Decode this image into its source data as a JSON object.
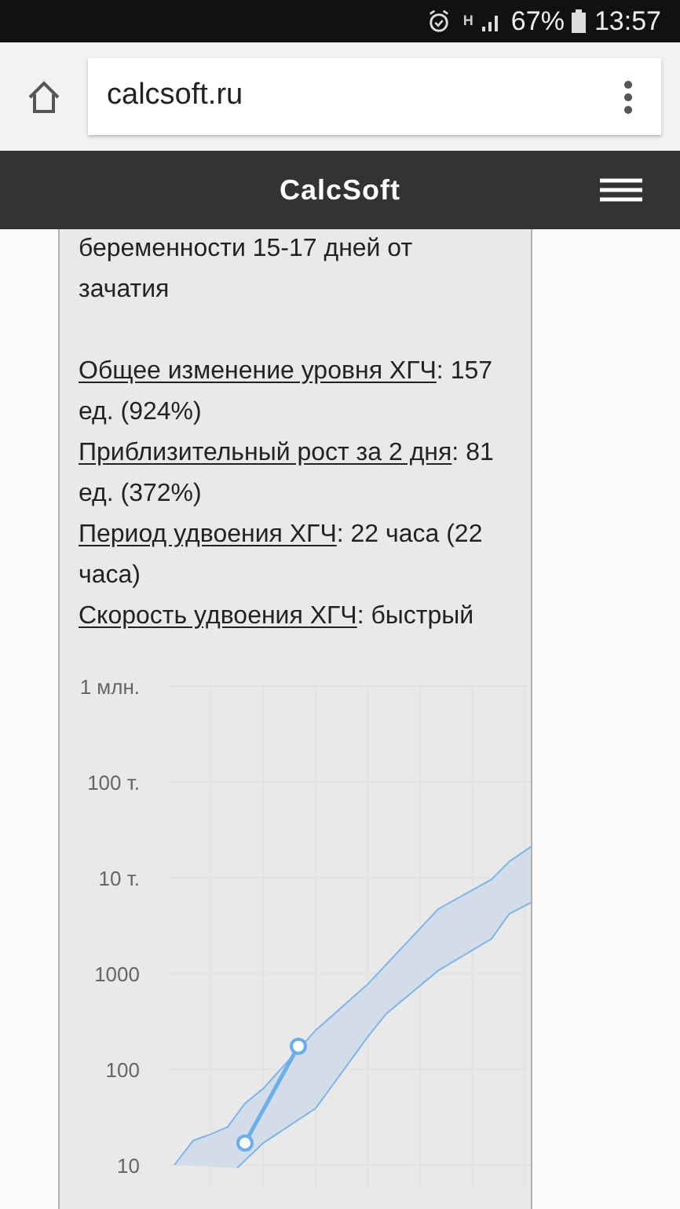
{
  "status_bar": {
    "network": "H",
    "battery": "67%",
    "time": "13:57"
  },
  "browser": {
    "url": "calcsoft.ru"
  },
  "header": {
    "title": "CalcSoft"
  },
  "result": {
    "intro": "беременности 15-17 дней от зачатия",
    "stats": [
      {
        "label": "Общее изменение уровня ХГЧ",
        "value": ": 157 ед. (924%)"
      },
      {
        "label": "Приблизительный рост за 2 дня",
        "value": ": 81 ед. (372%)"
      },
      {
        "label": "Период удвоения ХГЧ",
        "value": ": 22 часа (22 часа)"
      },
      {
        "label": "Скорость удвоения ХГЧ",
        "value": ": быстрый"
      }
    ]
  },
  "chart": {
    "y_axis_labels": [
      "1 млн.",
      "100 т.",
      "10 т.",
      "1000",
      "100",
      "10"
    ]
  }
}
